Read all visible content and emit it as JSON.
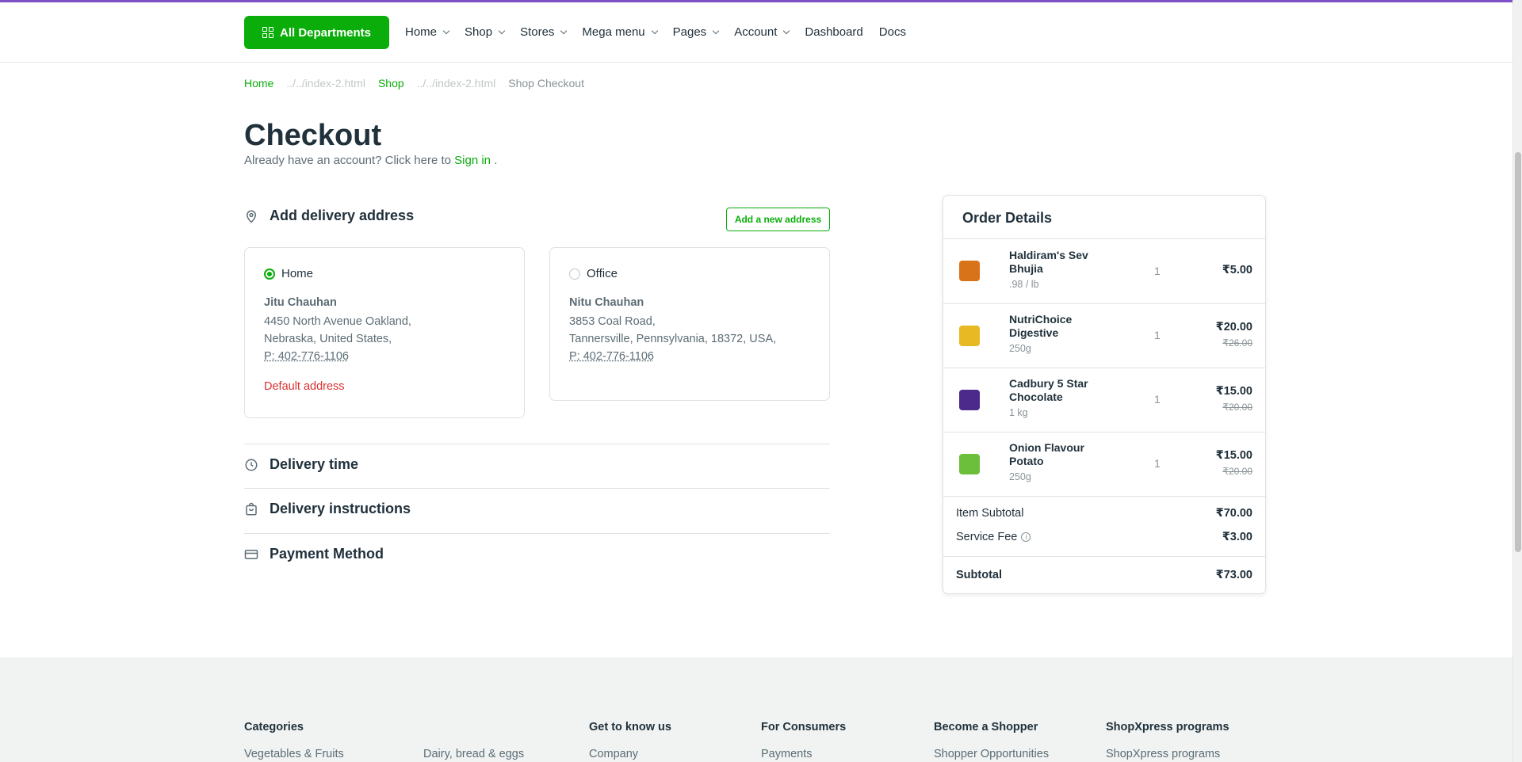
{
  "nav": {
    "departments_label": "All Departments",
    "items": [
      {
        "label": "Home",
        "dropdown": true
      },
      {
        "label": "Shop",
        "dropdown": true
      },
      {
        "label": "Stores",
        "dropdown": true
      },
      {
        "label": "Mega menu",
        "dropdown": true
      },
      {
        "label": "Pages",
        "dropdown": true
      },
      {
        "label": "Account",
        "dropdown": true
      },
      {
        "label": "Dashboard",
        "dropdown": false
      },
      {
        "label": "Docs",
        "dropdown": false
      }
    ]
  },
  "breadcrumb": {
    "home": "Home",
    "home_sep": "../../index-2.html",
    "shop": "Shop",
    "shop_sep": "../../index-2.html",
    "current": "Shop Checkout"
  },
  "page": {
    "title": "Checkout",
    "signin_prefix": "Already have an account? Click here to",
    "signin_link": "Sign in",
    "signin_suffix": "."
  },
  "delivery_address": {
    "heading": "Add delivery address",
    "add_button": "Add a new address",
    "addresses": [
      {
        "label": "Home",
        "selected": true,
        "name": "Jitu Chauhan",
        "line1": "4450 North Avenue Oakland,",
        "line2": "Nebraska, United States,",
        "phone": "P: 402-776-1106",
        "default_label": "Default address"
      },
      {
        "label": "Office",
        "selected": false,
        "name": "Nitu Chauhan",
        "line1": "3853 Coal Road,",
        "line2": "Tannersville, Pennsylvania, 18372, USA,",
        "phone": "P: 402-776-1106"
      }
    ]
  },
  "sections": {
    "delivery_time": "Delivery time",
    "delivery_instructions": "Delivery instructions",
    "payment_method": "Payment Method"
  },
  "order": {
    "title": "Order Details",
    "items": [
      {
        "name": "Haldiram's Sev Bhujia",
        "meta": ".98 / lb",
        "qty": "1",
        "price": "₹5.00",
        "old_price": "",
        "color": "#d9731a"
      },
      {
        "name": "NutriChoice Digestive",
        "meta": "250g",
        "qty": "1",
        "price": "₹20.00",
        "old_price": "₹26.00",
        "color": "#e8b923"
      },
      {
        "name": "Cadbury 5 Star Chocolate",
        "meta": "1 kg",
        "qty": "1",
        "price": "₹15.00",
        "old_price": "₹20.00",
        "color": "#4b2a8c"
      },
      {
        "name": "Onion Flavour Potato",
        "meta": "250g",
        "qty": "1",
        "price": "₹15.00",
        "old_price": "₹20.00",
        "color": "#6cbf3a"
      }
    ],
    "item_subtotal_label": "Item Subtotal",
    "item_subtotal": "₹70.00",
    "service_fee_label": "Service Fee",
    "service_fee": "₹3.00",
    "subtotal_label": "Subtotal",
    "subtotal": "₹73.00"
  },
  "footer": {
    "categories": "Categories",
    "cat_link1": "Vegetables & Fruits",
    "cat_link2": "Dairy, bread & eggs",
    "get_to_know": "Get to know us",
    "get_link": "Company",
    "consumers": "For Consumers",
    "consumers_link": "Payments",
    "shopper": "Become a Shopper",
    "shopper_link": "Shopper Opportunities",
    "programs": "ShopXpress programs",
    "programs_link": "ShopXpress programs"
  },
  "colors": {
    "accent": "#0aad0a",
    "danger": "#db3030",
    "topline": "#7f4fc7"
  }
}
